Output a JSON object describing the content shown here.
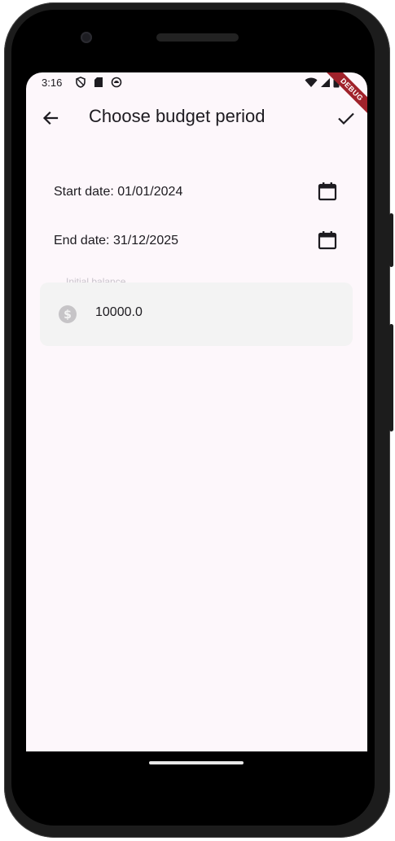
{
  "status_bar": {
    "time": "3:16",
    "left_icons": [
      "shield-icon",
      "sd-card-icon",
      "sync-icon"
    ],
    "right_icons": [
      "wifi-icon",
      "signal-icon",
      "battery-icon"
    ]
  },
  "debug_banner": "DEBUG",
  "app_bar": {
    "title": "Choose budget period",
    "back_icon": "arrow-back-icon",
    "confirm_icon": "check-icon"
  },
  "form": {
    "start_date_text": "Start date: 01/01/2024",
    "end_date_text": "End date: 31/12/2025",
    "initial_balance": {
      "label": "Initial balance",
      "value": "10000.0",
      "icon": "dollar-icon"
    }
  },
  "colors": {
    "screen_background": "#fdf7fb",
    "field_background": "#f3f3f3",
    "text": "#1d1b20",
    "debug_banner": "#a0222b"
  }
}
